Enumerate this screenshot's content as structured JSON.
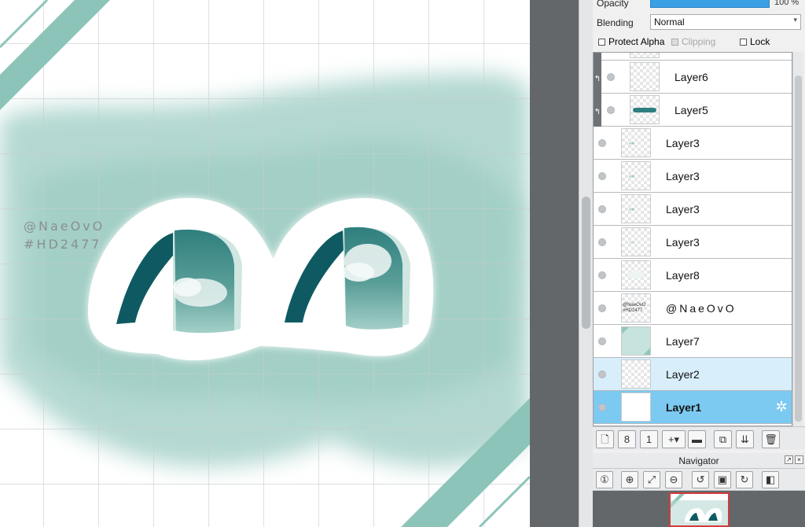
{
  "canvas": {
    "watermark_line1": "@NaeOvO",
    "watermark_line2": "#HD2477"
  },
  "layer_properties": {
    "opacity_label": "Opacity",
    "opacity_value": "100 %",
    "opacity_fraction": 1.0,
    "blending_label": "Blending",
    "blending_value": "Normal",
    "protect_alpha_label": "Protect Alpha",
    "clipping_label": "Clipping",
    "lock_label": "Lock"
  },
  "layers": [
    {
      "name": "Layer6",
      "clipped": true
    },
    {
      "name": "Layer5",
      "clipped": true
    },
    {
      "name": "Layer3",
      "clipped": false
    },
    {
      "name": "Layer3",
      "clipped": false
    },
    {
      "name": "Layer3",
      "clipped": false
    },
    {
      "name": "Layer3",
      "clipped": false
    },
    {
      "name": "Layer8",
      "clipped": false
    },
    {
      "name": "@NaeOvO",
      "clipped": false
    },
    {
      "name": "Layer7",
      "clipped": false
    },
    {
      "name": "Layer2",
      "clipped": false,
      "state": "hover"
    },
    {
      "name": "Layer1",
      "clipped": false,
      "state": "selected"
    }
  ],
  "thumb_text": {
    "line1": "@NaeOvO",
    "line2": "#HD2477"
  },
  "navigator": {
    "title": "Navigator"
  },
  "colors": {
    "accent_teal": "#8dc4b9",
    "dark_teal": "#0e5e66",
    "selection_blue": "#7cc9f1",
    "opacity_blue": "#3aa0e6"
  },
  "icons": {
    "layer_toolbar": [
      "new-layer-icon",
      "new-layer-8bit-icon",
      "new-layer-1bit-icon",
      "add-layer-menu-icon",
      "new-folder-icon",
      "duplicate-layer-icon",
      "merge-down-icon",
      "delete-layer-icon"
    ],
    "navigator_toolbar": [
      "zoom-actual-icon",
      "zoom-in-icon",
      "fit-window-icon",
      "zoom-out-icon",
      "rotate-ccw-icon",
      "fit-center-icon",
      "rotate-cw-icon",
      "flip-horizontal-icon"
    ]
  }
}
